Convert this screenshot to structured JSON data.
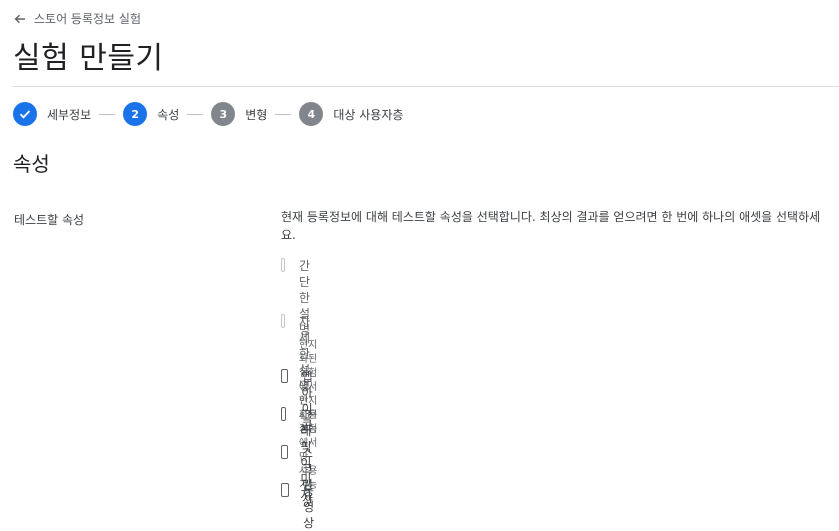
{
  "header": {
    "back_label": "스토어 등록정보 실험",
    "title": "실험 만들기"
  },
  "stepper": {
    "steps": [
      {
        "number": "1",
        "label": "세부정보",
        "state": "done"
      },
      {
        "number": "2",
        "label": "속성",
        "state": "active"
      },
      {
        "number": "3",
        "label": "변형",
        "state": "todo"
      },
      {
        "number": "4",
        "label": "대상 사용자층",
        "state": "todo"
      }
    ]
  },
  "section": {
    "title": "속성",
    "row_label": "테스트할 속성",
    "description": "현재 등록정보에 대해 테스트할 속성을 선택합니다. 최상의 결과를 얻으려면 한 번에 하나의 애셋을 선택하세요."
  },
  "options": [
    {
      "label": "간단한 설명",
      "sub": "현지화된 실험에서만 사용 가능",
      "disabled": true,
      "checked": false
    },
    {
      "label": "자세한 설명",
      "sub": "현지화된 실험에서만 사용 가능",
      "disabled": true,
      "checked": false
    },
    {
      "label": "앱 아이콘",
      "sub": "",
      "disabled": false,
      "checked": false
    },
    {
      "label": "그래픽 이미지",
      "sub": "",
      "disabled": false,
      "checked": false
    },
    {
      "label": "스크린샷",
      "sub": "",
      "disabled": false,
      "checked": false
    },
    {
      "label": "동영상",
      "sub": "",
      "disabled": false,
      "checked": false
    }
  ],
  "colors": {
    "accent": "#1a73e8",
    "inactive_step": "#80868b",
    "divider": "#dadce0"
  }
}
